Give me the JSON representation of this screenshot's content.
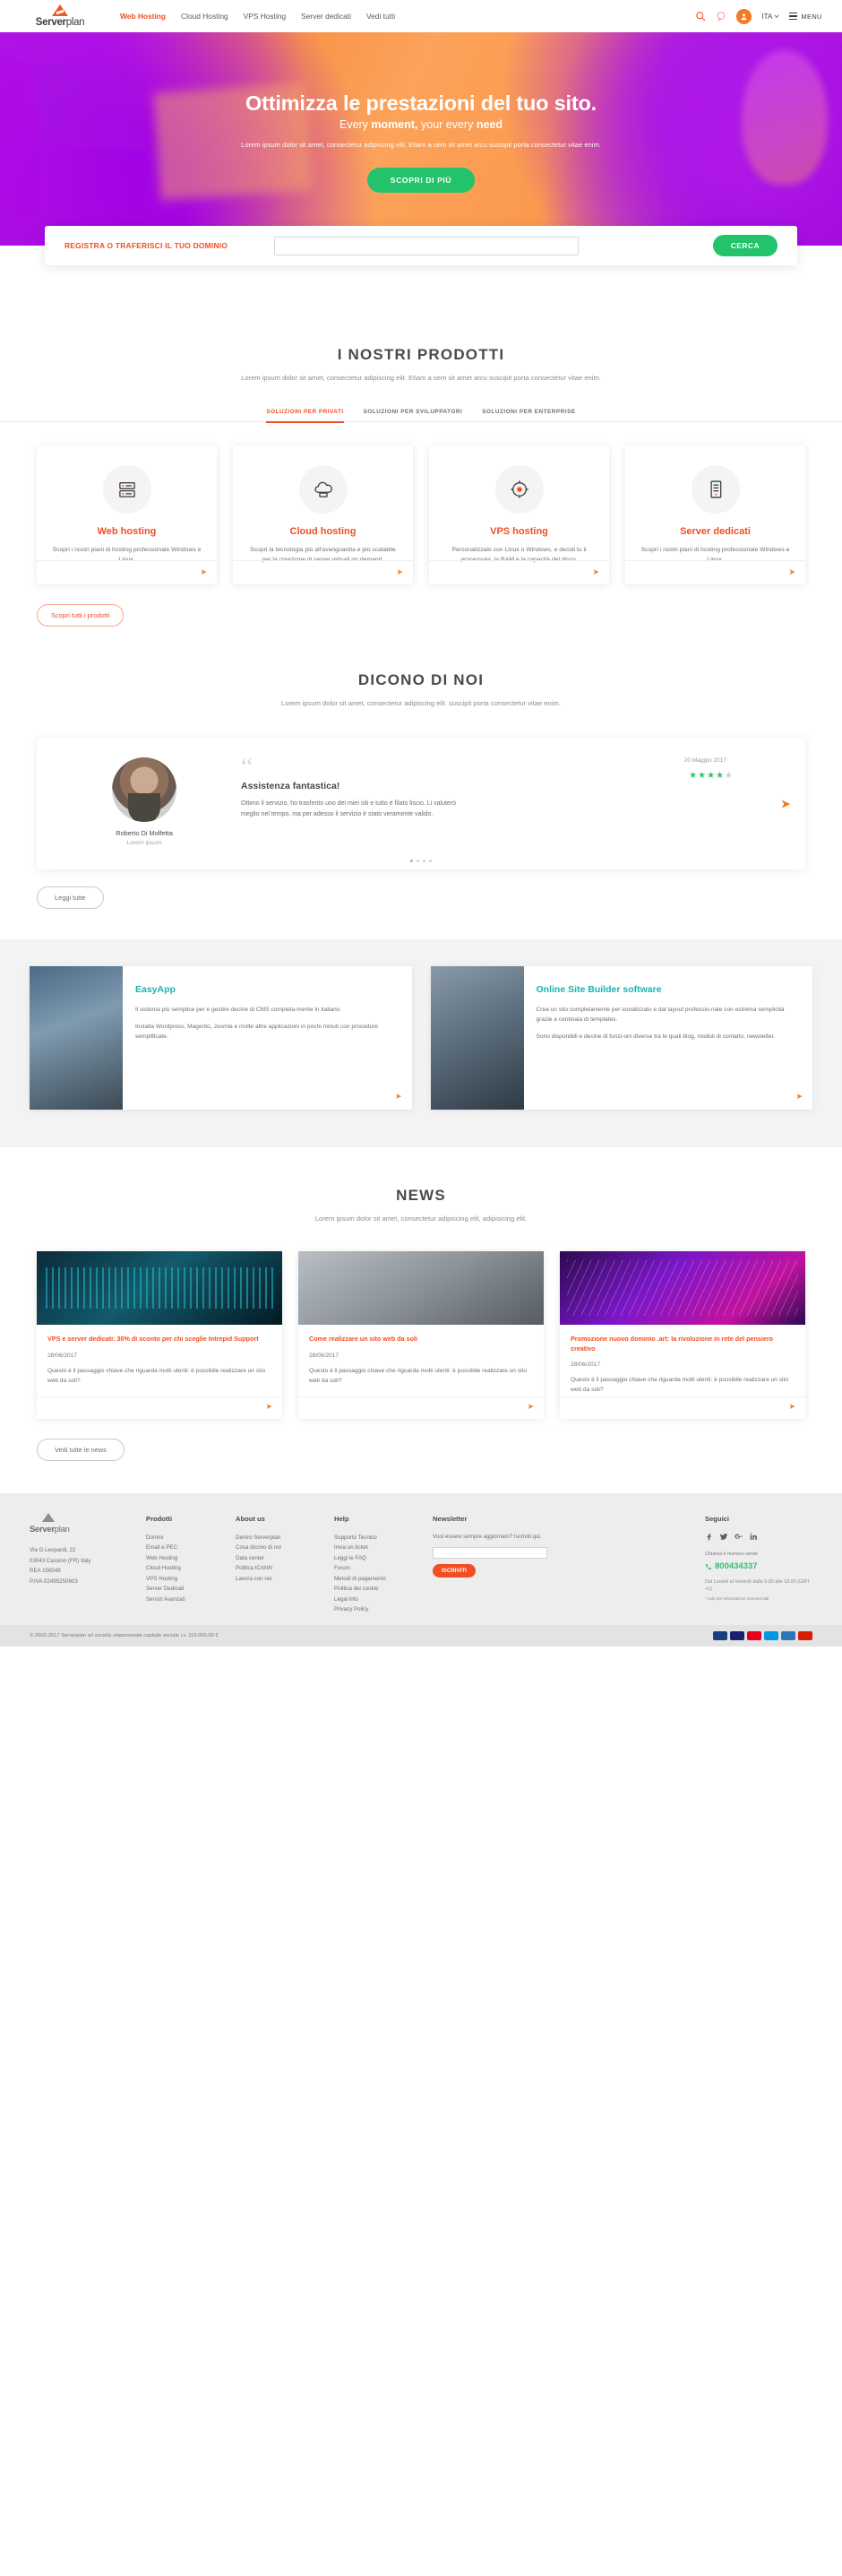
{
  "header": {
    "logo_text_a": "Server",
    "logo_text_b": "plan",
    "nav": [
      {
        "label": "Web Hosting",
        "active": true
      },
      {
        "label": "Cloud Hosting",
        "active": false
      },
      {
        "label": "VPS Hosting",
        "active": false
      },
      {
        "label": "Server dedicati",
        "active": false
      },
      {
        "label": "Vedi tutti",
        "active": false
      }
    ],
    "lang": "ITA",
    "menu_label": "MENU"
  },
  "hero": {
    "title": "Ottimizza le prestazioni del tuo sito.",
    "subtitle_a": "Every ",
    "subtitle_b": "moment,",
    "subtitle_c": " your every ",
    "subtitle_d": "need",
    "paragraph": "Lorem ipsum dolor sit amet, consectetur adipiscing elit. Etiam a sem sit amet arcu suscipit porta consectetur vitae enim.",
    "cta": "SCOPRI DI PIÙ"
  },
  "domain": {
    "label": "REGISTRA O TRAFERISCI IL TUO DOMINIO",
    "placeholder": "",
    "value": "",
    "button": "CERCA"
  },
  "products": {
    "title": "I NOSTRI PRODOTTI",
    "subtitle": "Lorem ipsum dolor sit amet, consectetur adipiscing elit. Etiam a sem sit amet arcu suscipit porta consectetur vitae enim.",
    "tabs": [
      {
        "label": "SOLUZIONI PER PRIVATI",
        "active": true
      },
      {
        "label": "SOLUZIONI PER SVILUPPATORI",
        "active": false
      },
      {
        "label": "SOLUZIONI PER ENTERPRISE",
        "active": false
      }
    ],
    "cards": [
      {
        "icon": "server-rack-icon",
        "title": "Web hosting",
        "text": "Scopri i nostri piani di hosting professionale Windows e Linux."
      },
      {
        "icon": "cloud-server-icon",
        "title": "Cloud hosting",
        "text": "Scopri la tecnologia più all'avanguardia e più scalabile per la  creazione di server virtuali on demand."
      },
      {
        "icon": "vps-gear-icon",
        "title": "VPS hosting",
        "text": "Personalizzalo con Linux o Windows, e decidi tu il processore, la RAM e la capacità del disco."
      },
      {
        "icon": "dedicated-server-icon",
        "title": "Server dedicati",
        "text": "Scopri i nostri piani di hosting professionale Windows e Linux."
      }
    ],
    "all_button": "Scopri tutti i prodotti"
  },
  "testimonials": {
    "title": "DICONO DI NOI",
    "subtitle": "Lorem ipsum dolor sit amet, consectetur adipiscing elit. suscipit porta consectetur vitae enim.",
    "item": {
      "name": "Roberto Di Molfetta",
      "role": "Lorem ipsum",
      "date": "20 Maggio 2017",
      "heading": "Assistenza fantastica!",
      "body": "Ottimo il servizio, ho trasferito uno dei miei siti e tutto è filato liscio. Li valuterò meglio nel tempo, ma per adesso il servizio è stato veramente valido.",
      "stars_filled": 4,
      "stars_total": 5
    },
    "dots": 4,
    "active_dot": 0,
    "read_all": "Leggi tutte"
  },
  "apps": [
    {
      "photo": "office-team-photo",
      "title": "EasyApp",
      "paragraphs": [
        "Il sistema più semplice per e gestire decine di CMS completa-mente in italiano.",
        "Installa Wordpress, Magento, Joomla e molte altre applicazioni in pochi minuti con procedure semplificate."
      ]
    },
    {
      "photo": "businessman-photo",
      "title": "Online Site Builder software",
      "paragraphs": [
        "Crea un sito completamente per-sonalizzato e dal layout professio-nale con estrema semplicità grazie a centinaia di templates.",
        "Sono disponibili e decine di funzi-oni diverse tra le quali blog, moduli di contatto, newsletter."
      ]
    }
  ],
  "news": {
    "title": "NEWS",
    "subtitle": "Lorem ipsum dolor sit amet, consectetur adipiscing elit, adipisicing elit.",
    "items": [
      {
        "image": "datacenter-photo",
        "title": "VPS e server dedicati: 30% di sconto per chi sceglie Intrepid Support",
        "date": "28/06/2017",
        "text": "Questo è il passaggio chiave che riguarda molti utenti: è possibile realizzare un sito web da soli?"
      },
      {
        "image": "man-glasses-photo",
        "title": "Come realizzare un sito web da soli",
        "date": "28/06/2017",
        "text": "Questo è il passaggio chiave che riguarda molti utenti: è possibile realizzare un sito web da soli?"
      },
      {
        "image": "purple-server-photo",
        "title": "Promozione nuovo dominio .art: la rivoluzione in rete del pensiero creativo",
        "date": "28/06/2017",
        "text": "Questo è il passaggio chiave che riguarda molti utenti: è possibile realizzare un sito web da soli?"
      }
    ],
    "all_button": "Vedi tutte le news"
  },
  "footer": {
    "logo_text_a": "Server",
    "logo_text_b": "plan",
    "address": [
      "Via G.Leopardi, 22",
      "03043 Cassino (FR) Italy",
      "REA 156549",
      "P.IVA 02495250603"
    ],
    "columns": [
      {
        "heading": "Prodotti",
        "links": [
          "Domini",
          "Email e PEC",
          "Web Hosting",
          "Cloud Hosting",
          "VPS Hosting",
          "Server Dedicati",
          "Servizi Avanzati"
        ]
      },
      {
        "heading": "About us",
        "links": [
          "Dentro Serverplan",
          "Cosa dicono di noi",
          "Data center",
          "Politica ICANN",
          "Lavora con noi"
        ]
      },
      {
        "heading": "Help",
        "links": [
          "Supporto Tecnico",
          "Invia un ticket",
          "Leggi le FAQ",
          "Forum",
          "Metodi di pagamento",
          "Politica dei cookie",
          "Legal info",
          "Privacy Policy"
        ]
      }
    ],
    "newsletter": {
      "heading": "Newsletter",
      "text": "Vuoi essere sempre aggiornato? Iscriviti qui.",
      "placeholder": "",
      "value": "",
      "button": "ISCRIVITI"
    },
    "social": {
      "heading": "Seguici",
      "icons": [
        "facebook-icon",
        "twitter-icon",
        "google-plus-icon",
        "linkedin-icon"
      ],
      "phone_label": "Chiama il numero verde",
      "phone": "800434337",
      "hours": "Dal Lunedì al Venerdì dalle 9.00 alle 18.00 (GMT +1)",
      "hours_note": "* solo per informazioni commerciali"
    },
    "copyright": "© 2002-2017 Serverplan srl società unipersonale capitale sociale i.v. 119.000,00 €",
    "payments": [
      "paypal",
      "visa",
      "mastercard",
      "maestro",
      "amex",
      "postepay"
    ]
  },
  "colors": {
    "brand_orange": "#f04e23",
    "green": "#22c36a",
    "teal": "#18b3b3",
    "purple": "#a714e0"
  }
}
